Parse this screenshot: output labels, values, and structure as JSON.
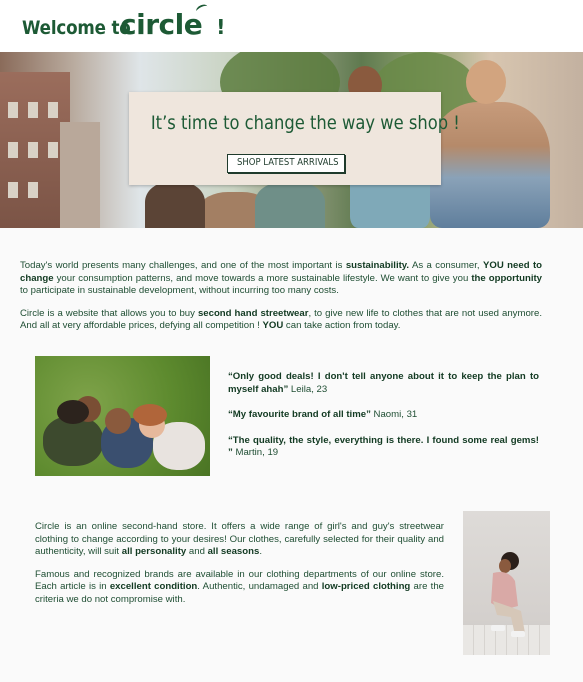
{
  "header": {
    "welcome_text": "Welcome to",
    "logo_text": "circle",
    "exclamation": "!"
  },
  "hero": {
    "title": "It’s time to change the way we shop !",
    "button_label": "SHOP LATEST ARRIVALS"
  },
  "intro": {
    "p1": [
      {
        "t": "Today's world presents many challenges, and one of the most important is ",
        "b": false
      },
      {
        "t": "sustainability.",
        "b": true
      },
      {
        "t": "  As a consumer, ",
        "b": false
      },
      {
        "t": "YOU need to change",
        "b": true
      },
      {
        "t": " your consumption patterns, and move towards a more sustainable lifestyle. We want to give you ",
        "b": false
      },
      {
        "t": "the opportunity",
        "b": true
      },
      {
        "t": " to participate in sustainable development, without incurring too many costs.",
        "b": false
      }
    ],
    "p2": [
      {
        "t": "Circle is a website that allows you to buy ",
        "b": false
      },
      {
        "t": "second hand streetwear",
        "b": true
      },
      {
        "t": ", to give new life to clothes that are not used anymore. And all at very affordable prices, defying all competition ! ",
        "b": false
      },
      {
        "t": "YOU",
        "b": true
      },
      {
        "t": " can take action from today.",
        "b": false
      }
    ]
  },
  "testimonials": [
    {
      "quote": "“Only good deals! I don't tell anyone about it to keep the plan to myself ahah”",
      "author": " Leila, 23"
    },
    {
      "quote": "“My favourite brand of all time”",
      "author": " Naomi, 31"
    },
    {
      "quote": "“The quality, the style, everything is there. I found some real gems! ”",
      "author": " Martin, 19"
    }
  ],
  "about": {
    "p1": [
      {
        "t": "Circle is an online second-hand store. It offers a wide range of girl's and guy's streetwear clothing to change according to your desires! Our clothes, carefully selected for their quality and authenticity, will suit ",
        "b": false
      },
      {
        "t": "all personality",
        "b": true
      },
      {
        "t": " and ",
        "b": false
      },
      {
        "t": "all seasons",
        "b": true
      },
      {
        "t": ".",
        "b": false
      }
    ],
    "p2": [
      {
        "t": "Famous and recognized brands are available in our clothing departments of our online store. Each article is in ",
        "b": false
      },
      {
        "t": "excellent condition",
        "b": true
      },
      {
        "t": ". Authentic, undamaged and ",
        "b": false
      },
      {
        "t": "low-priced clothing",
        "b": true
      },
      {
        "t": " are the criteria we do not compromise with.",
        "b": false
      }
    ]
  },
  "colors": {
    "brand_green": "#1d5a35",
    "text_green": "#1f4e33",
    "card_beige": "#efe6dd"
  }
}
